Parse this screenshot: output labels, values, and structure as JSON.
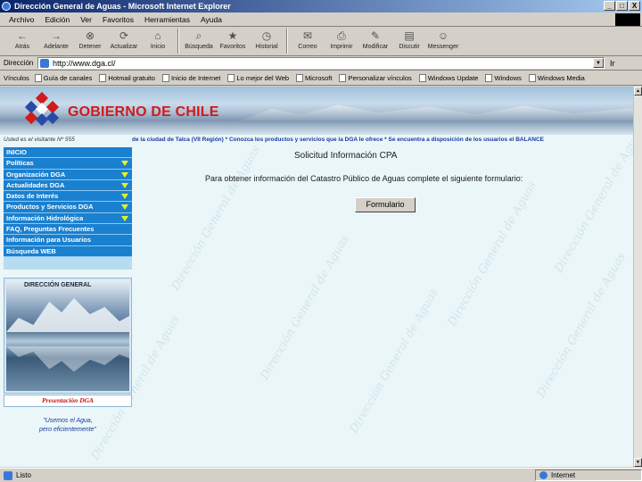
{
  "window": {
    "title": "Dirección General de Aguas - Microsoft Internet Explorer",
    "controls": [
      "_",
      "□",
      "X"
    ]
  },
  "menu": [
    "Archivo",
    "Edición",
    "Ver",
    "Favoritos",
    "Herramientas",
    "Ayuda"
  ],
  "toolbar": {
    "buttons": [
      {
        "label": "Atrás",
        "icon": "back-arrow-icon",
        "glyph": "←"
      },
      {
        "label": "Adelante",
        "icon": "forward-arrow-icon",
        "glyph": "→"
      },
      {
        "label": "Detener",
        "icon": "stop-icon",
        "glyph": "⊗"
      },
      {
        "label": "Actualizar",
        "icon": "refresh-icon",
        "glyph": "⟳"
      },
      {
        "label": "Inicio",
        "icon": "home-icon",
        "glyph": "⌂"
      },
      {
        "label": "Búsqueda",
        "icon": "search-icon",
        "glyph": "⌕"
      },
      {
        "label": "Favoritos",
        "icon": "favorites-icon",
        "glyph": "★"
      },
      {
        "label": "Historial",
        "icon": "history-icon",
        "glyph": "◷"
      },
      {
        "label": "Correo",
        "icon": "mail-icon",
        "glyph": "✉"
      },
      {
        "label": "Imprimir",
        "icon": "print-icon",
        "glyph": "⎙"
      },
      {
        "label": "Modificar",
        "icon": "edit-icon",
        "glyph": "✎"
      },
      {
        "label": "Discutir",
        "icon": "discuss-icon",
        "glyph": "▤"
      },
      {
        "label": "Messenger",
        "icon": "messenger-icon",
        "glyph": "☺"
      }
    ]
  },
  "address": {
    "label": "Dirección",
    "url": "http://www.dga.cl/",
    "go_label": "Ir"
  },
  "links": {
    "label": "Vínculos",
    "items": [
      "Guía de canales",
      "Hotmail gratuito",
      "Inicio de Internet",
      "Lo mejor del Web",
      "Microsoft",
      "Personalizar vínculos",
      "Windows Update",
      "Windows",
      "Windows Media"
    ]
  },
  "page": {
    "brand": "GOBIERNO DE CHILE",
    "visitors": "Usted es el visitante Nº 555",
    "ticker": "de la ciudad de Talca (VII Región)   *   Conozca los productos y servicios que la DGA le ofrece   *   Se encuentra a disposición de los usuarios el BALANCE",
    "nav": [
      {
        "label": "INICIO",
        "arrow": false
      },
      {
        "label": "Políticas",
        "arrow": true
      },
      {
        "label": "Organización DGA",
        "arrow": true
      },
      {
        "label": "Actualidades DGA",
        "arrow": true
      },
      {
        "label": "Datos de Interés",
        "arrow": true
      },
      {
        "label": "Productos y Servicios DGA",
        "arrow": true
      },
      {
        "label": "Información Hidrológica",
        "arrow": true
      },
      {
        "label": "FAQ, Preguntas Frecuentes",
        "arrow": false
      },
      {
        "label": "Información para Usuarios",
        "arrow": false
      },
      {
        "label": "Búsqueda WEB",
        "arrow": false
      }
    ],
    "photo_caption": "DIRECCIÓN GENERAL",
    "presentation_link": "Presentación DGA",
    "slogan_line1": "\"Usemos el Agua,",
    "slogan_line2": "pero eficientemente\"",
    "watermark": "Dirección General de Aguas",
    "content_title": "Solicitud Información CPA",
    "content_instructions": "Para obtener información del Catastro Público de Aguas complete el siguiente formulario:",
    "form_button": "Formulario"
  },
  "status": {
    "text": "Listo",
    "zone": "Internet"
  },
  "colors": {
    "nav_bg": "#1a80d0",
    "nav_arrow": "#e8f020",
    "brand_red": "#d11a1a",
    "link_blue": "#1a3aa0"
  }
}
